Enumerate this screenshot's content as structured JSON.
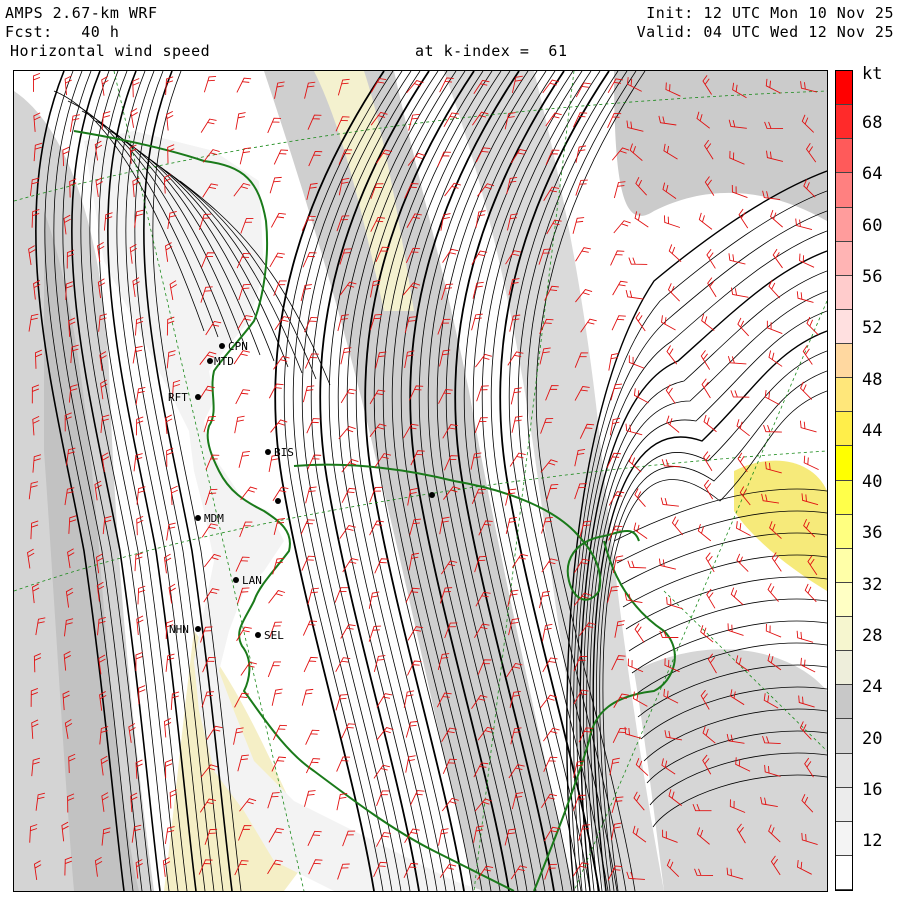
{
  "header": {
    "model": "AMPS 2.67-km WRF",
    "forecast": "Fcst:   40 h",
    "field": "Horizontal wind speed",
    "level": "at k-index =  61",
    "init": "Init: 12 UTC Mon 10 Nov 25",
    "valid": "Valid: 04 UTC Wed 12 Nov 25"
  },
  "stations": [
    {
      "label": "CPN"
    },
    {
      "label": "MTD"
    },
    {
      "label": "RFT"
    },
    {
      "label": "BIS"
    },
    {
      "label": "MDM"
    },
    {
      "label": "LAN"
    },
    {
      "label": "NHN"
    },
    {
      "label": "SEL"
    }
  ],
  "colorbar": {
    "unit": "kt",
    "labels": [
      "68",
      "64",
      "60",
      "56",
      "52",
      "48",
      "44",
      "40",
      "36",
      "32",
      "28",
      "24",
      "20",
      "16",
      "12"
    ],
    "colors": [
      "#ff0000",
      "#ff2a2a",
      "#ff5a5a",
      "#ff8080",
      "#ff9c9c",
      "#ffb4b4",
      "#ffcccc",
      "#ffe0e0",
      "#ffd8a0",
      "#ffe77a",
      "#ffee4a",
      "#ffff00",
      "#ffff4a",
      "#ffff80",
      "#ffffa8",
      "#ffffc4",
      "#f6f6cf",
      "#eeeedb",
      "#c8c8c8",
      "#d6d6d6",
      "#e4e4e4",
      "#ececec",
      "#f4f4f4",
      "#ffffff"
    ]
  }
}
